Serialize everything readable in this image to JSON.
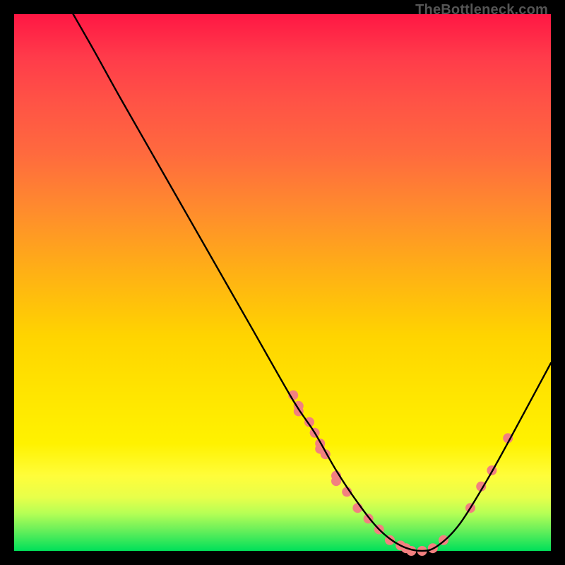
{
  "watermark": "TheBottleneck.com",
  "chart_data": {
    "type": "line",
    "title": "",
    "xlabel": "",
    "ylabel": "",
    "xlim": [
      0,
      100
    ],
    "ylim": [
      0,
      100
    ],
    "grid": false,
    "legend": false,
    "series": [
      {
        "name": "bottleneck-curve",
        "color": "#000000",
        "x": [
          11,
          15,
          20,
          28,
          36,
          44,
          52,
          56,
          60,
          64,
          68,
          72,
          76,
          79,
          83,
          88,
          93,
          100
        ],
        "y": [
          100,
          93,
          84,
          70,
          56,
          42,
          28,
          22,
          15,
          9,
          4,
          1,
          0,
          1,
          5,
          13,
          22,
          35
        ]
      }
    ],
    "scatter_points": {
      "name": "highlight-points",
      "color": "#f28080",
      "radius_px": 7,
      "x": [
        52,
        53,
        53,
        55,
        56,
        57,
        57,
        58,
        60,
        60,
        62,
        64,
        66,
        68,
        70,
        72,
        73,
        74,
        76,
        78,
        80,
        85,
        87,
        89,
        92
      ],
      "y": [
        29,
        27,
        26,
        24,
        22,
        20,
        19,
        18,
        14,
        13,
        11,
        8,
        6,
        4,
        2,
        1,
        0.5,
        0,
        0,
        0.5,
        2,
        8,
        12,
        15,
        21
      ]
    }
  }
}
